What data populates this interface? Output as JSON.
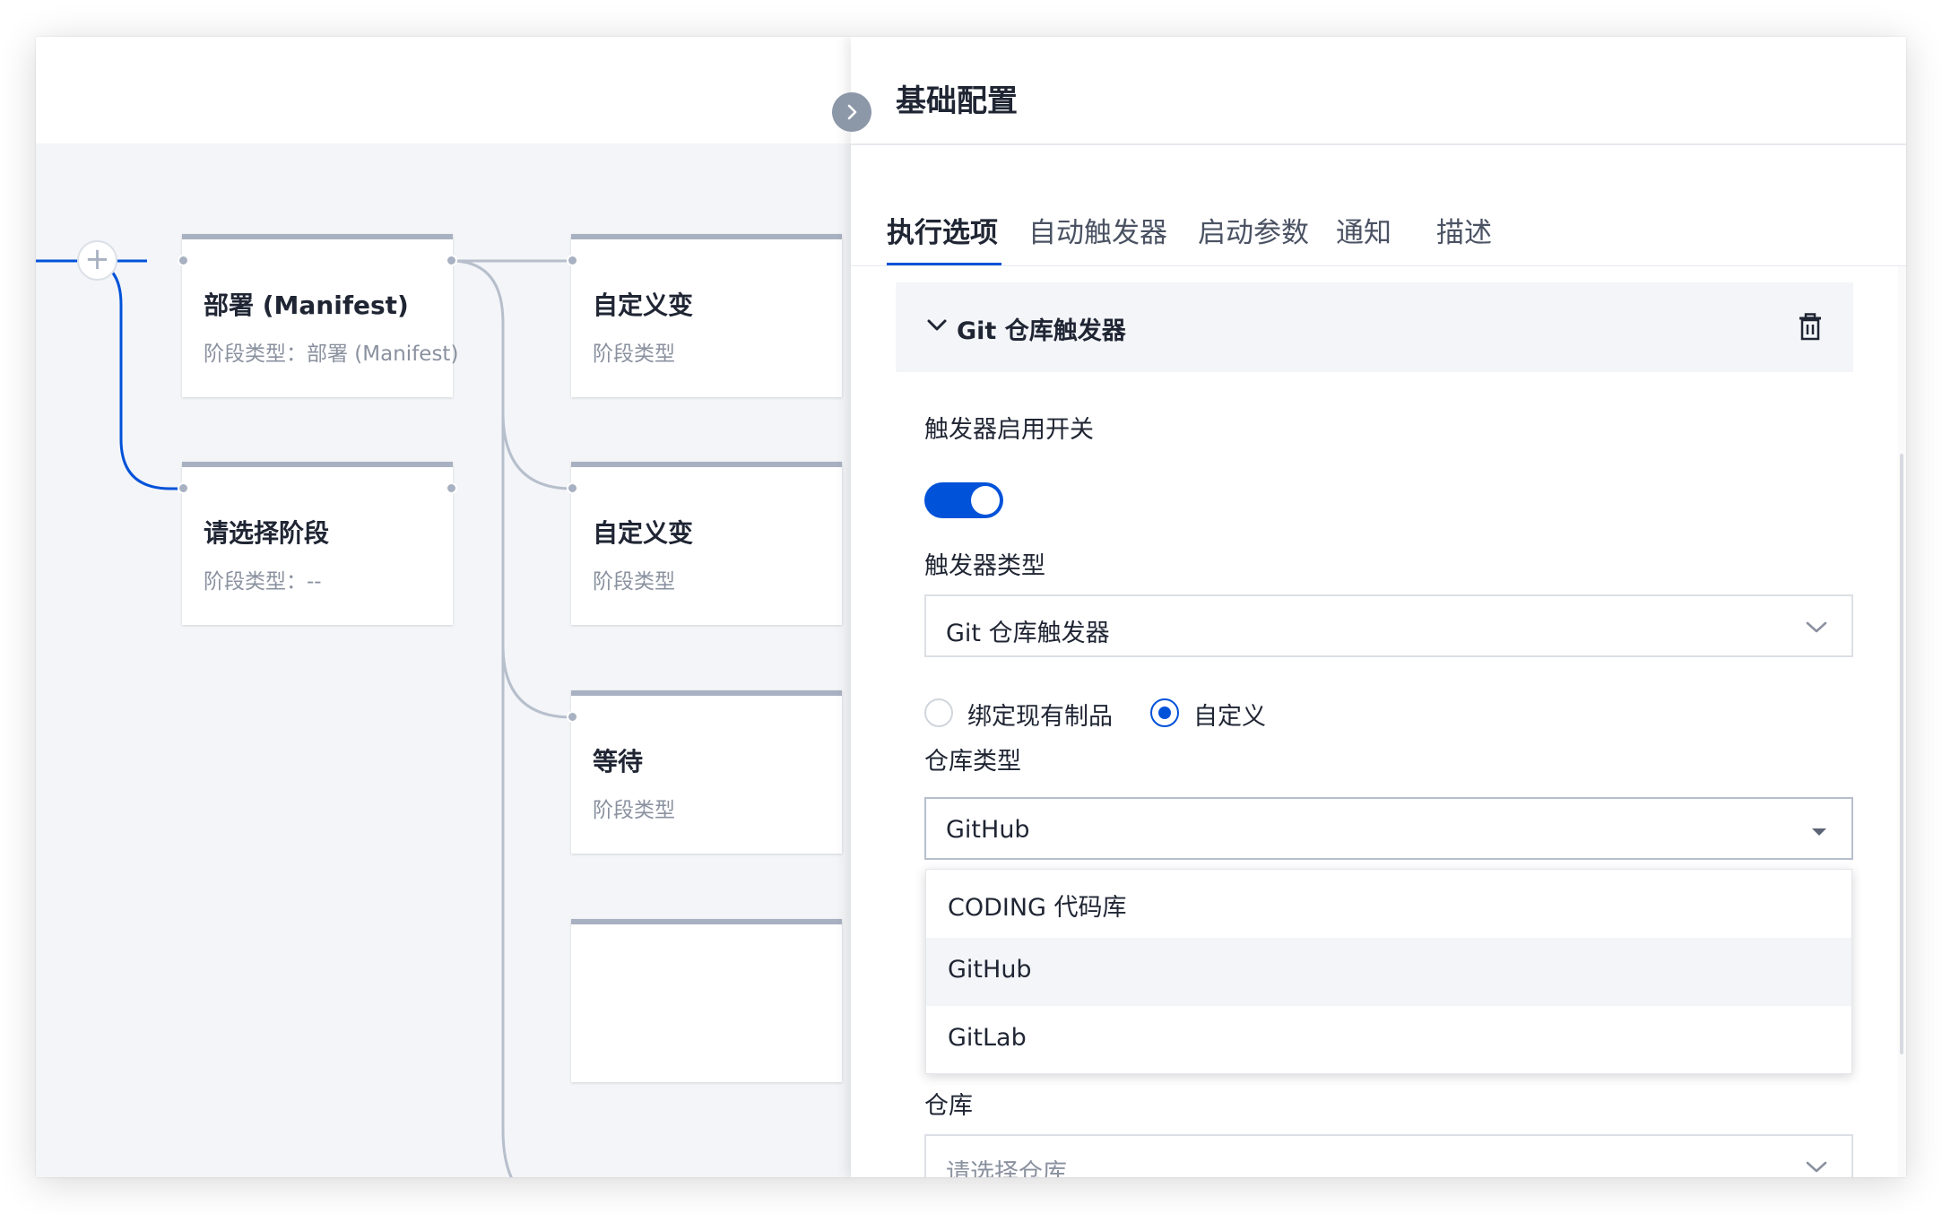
{
  "pipeline": {
    "stages": [
      {
        "name": "部署 (Manifest)",
        "type": "阶段类型：部署 (Manifest)"
      },
      {
        "name": "请选择阶段",
        "type": "阶段类型：--"
      },
      {
        "name": "自定义变",
        "type": "阶段类型"
      },
      {
        "name": "自定义变",
        "type": "阶段类型"
      },
      {
        "name": "等待",
        "type": "阶段类型"
      }
    ],
    "add_icon": "plus-icon"
  },
  "drawer": {
    "title": "基础配置",
    "collapse_icon": "chevron-right-icon",
    "tabs": [
      {
        "label": "执行选项",
        "active": true
      },
      {
        "label": "自动触发器",
        "active": false
      },
      {
        "label": "启动参数",
        "active": false
      },
      {
        "label": "通知",
        "active": false
      },
      {
        "label": "描述",
        "active": false
      }
    ],
    "section": {
      "title": "Git 仓库触发器",
      "expand_icon": "chevron-down-icon",
      "delete_icon": "trash-icon",
      "trigger_switch": {
        "label": "触发器启用开关",
        "enabled": true
      },
      "trigger_type": {
        "label": "触发器类型",
        "value": "Git 仓库触发器"
      },
      "source": {
        "options": [
          {
            "label": "绑定现有制品",
            "checked": false
          },
          {
            "label": "自定义",
            "checked": true
          }
        ]
      },
      "repo_type": {
        "label": "仓库类型",
        "value": "GitHub",
        "options": [
          "CODING 代码库",
          "GitHub",
          "GitLab"
        ],
        "hovered": "GitHub"
      },
      "repo": {
        "label": "仓库",
        "placeholder": "请选择仓库"
      }
    }
  },
  "colors": {
    "accent": "#0052d9",
    "canvas_bg": "#f3f5f8",
    "connector": "#a8b1c1"
  }
}
